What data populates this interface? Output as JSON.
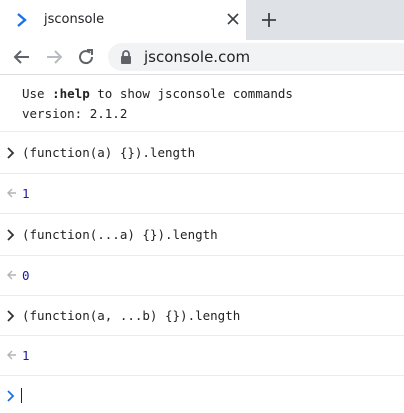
{
  "tab": {
    "title": "jsconsole"
  },
  "address": {
    "url": "jsconsole.com"
  },
  "intro": {
    "line1_pre": "Use ",
    "line1_bold": ":help",
    "line1_post": " to show jsconsole commands",
    "line2": "version: 2.1.2"
  },
  "entries": [
    {
      "input": "(function(a) {}).length",
      "output": "1"
    },
    {
      "input": "(function(...a) {}).length",
      "output": "0"
    },
    {
      "input": "(function(a, ...b) {}).length",
      "output": "1"
    }
  ],
  "prompt": {
    "value": ""
  },
  "icons": {
    "favicon": "chevron-right-icon",
    "close": "close-icon",
    "new_tab": "plus-icon",
    "back": "arrow-left-icon",
    "forward": "arrow-right-icon",
    "reload": "reload-icon",
    "lock": "lock-icon",
    "input_marker": "chevron-right-icon",
    "output_marker": "return-arrow-icon"
  },
  "colors": {
    "accent": "#1a73e8",
    "output_value": "#1a1aa6",
    "input_chevron": "#333333",
    "output_marker": "#b4b4b4"
  }
}
